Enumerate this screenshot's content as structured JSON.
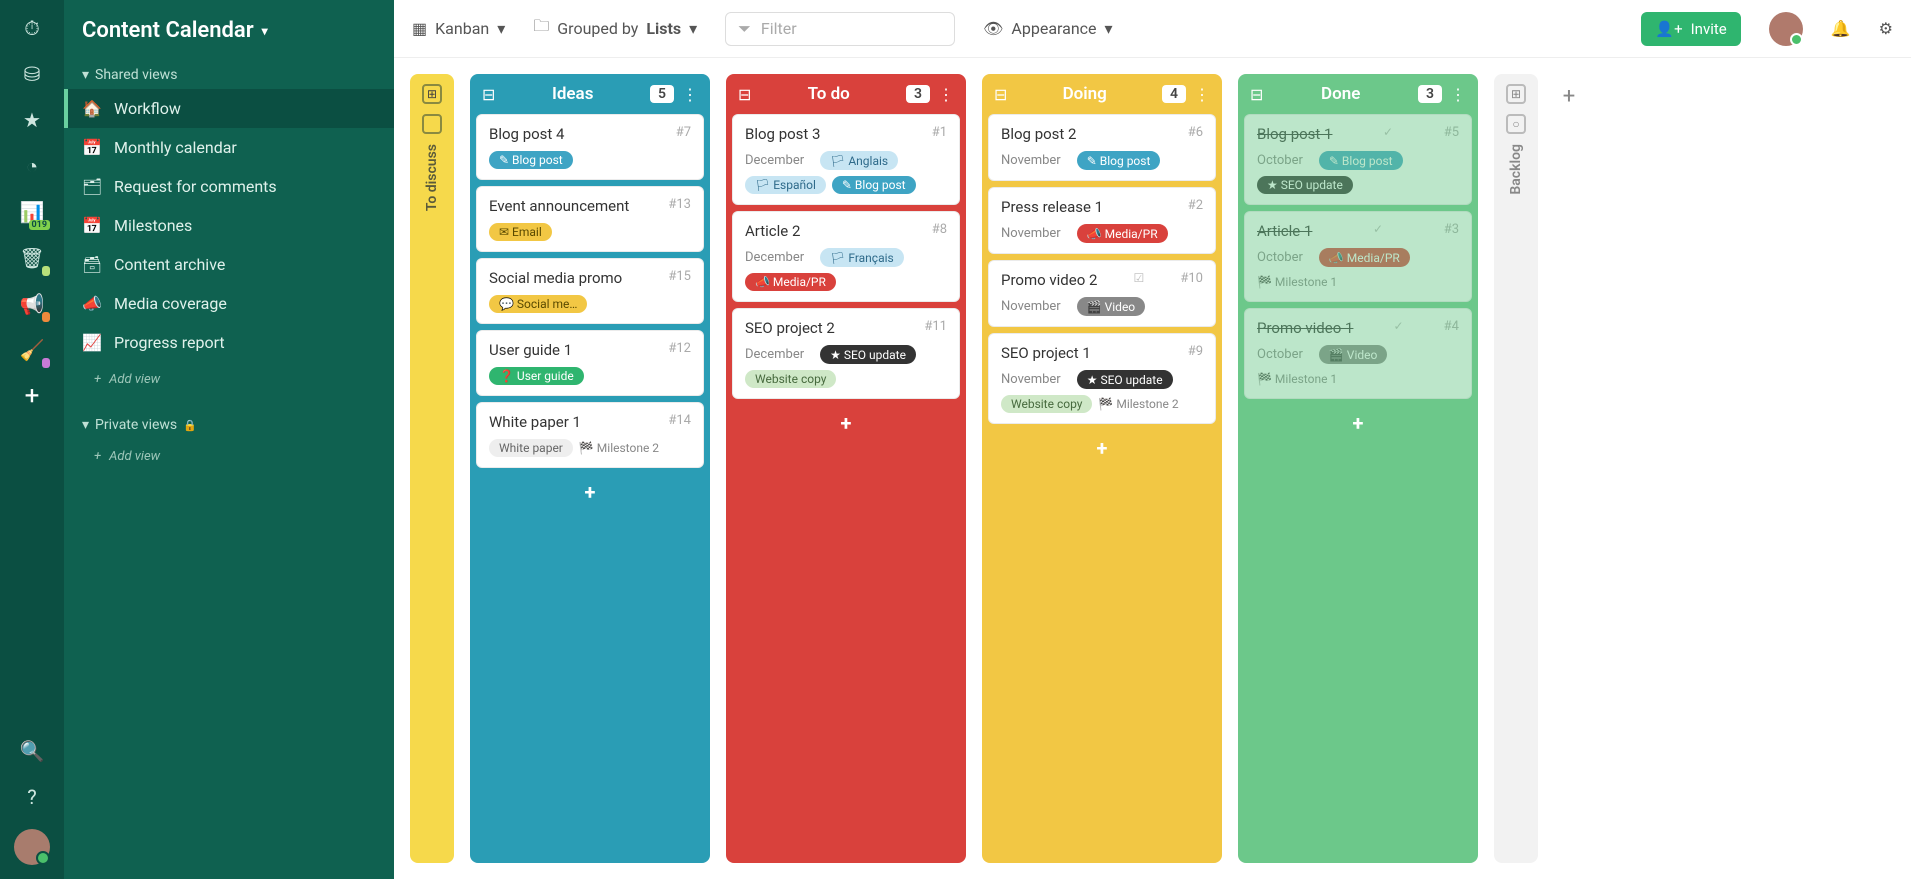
{
  "app": {
    "title": "Content Calendar"
  },
  "sidebar": {
    "shared_label": "Shared views",
    "private_label": "Private views",
    "add_view": "Add view",
    "items": [
      {
        "icon": "🏠",
        "label": "Workflow",
        "active": true
      },
      {
        "icon": "📅",
        "label": "Monthly calendar"
      },
      {
        "icon": "🗂",
        "label": "Request for comments"
      },
      {
        "icon": "📅",
        "label": "Milestones"
      },
      {
        "icon": "🗃",
        "label": "Content archive"
      },
      {
        "icon": "📣",
        "label": "Media coverage"
      },
      {
        "icon": "📈",
        "label": "Progress report"
      }
    ]
  },
  "topbar": {
    "view": "Kanban",
    "group_prefix": "Grouped by",
    "group_value": "Lists",
    "filter_placeholder": "Filter",
    "appearance": "Appearance",
    "invite": "Invite"
  },
  "collapsed_left": {
    "title": "To discuss"
  },
  "collapsed_right": {
    "title": "Backlog"
  },
  "columns": [
    {
      "title": "Ideas",
      "count": "5",
      "style": "col-ideas",
      "cards": [
        {
          "title": "Blog post 4",
          "id": "#7",
          "tags": [
            {
              "cls": "tag-blog",
              "icon": "✎",
              "label": "Blog post"
            }
          ]
        },
        {
          "title": "Event announcement",
          "id": "#13",
          "tags": [
            {
              "cls": "tag-email",
              "icon": "✉",
              "label": "Email"
            }
          ]
        },
        {
          "title": "Social media promo",
          "id": "#15",
          "tags": [
            {
              "cls": "tag-social",
              "icon": "💬",
              "label": "Social me…"
            }
          ]
        },
        {
          "title": "User guide 1",
          "id": "#12",
          "tags": [
            {
              "cls": "tag-userguide",
              "icon": "❓",
              "label": "User guide"
            }
          ]
        },
        {
          "title": "White paper 1",
          "id": "#14",
          "tags": [
            {
              "cls": "tag-white",
              "label": "White paper"
            },
            {
              "cls": "tag-mile",
              "icon": "🏁",
              "label": "Milestone 2"
            }
          ]
        }
      ]
    },
    {
      "title": "To do",
      "count": "3",
      "style": "col-todo",
      "cards": [
        {
          "title": "Blog post 3",
          "id": "#1",
          "tags": [
            {
              "cls": "tag-date",
              "label": "December"
            },
            {
              "cls": "tag-flag",
              "icon": "🏳",
              "label": "Anglais"
            },
            {
              "cls": "tag-flag",
              "icon": "🏳",
              "label": "Español"
            },
            {
              "cls": "tag-blog",
              "icon": "✎",
              "label": "Blog post"
            }
          ]
        },
        {
          "title": "Article 2",
          "id": "#8",
          "tags": [
            {
              "cls": "tag-date",
              "label": "December"
            },
            {
              "cls": "tag-flag",
              "icon": "🏳",
              "label": "Français"
            },
            {
              "cls": "tag-media",
              "icon": "📣",
              "label": "Media/PR"
            }
          ]
        },
        {
          "title": "SEO project 2",
          "id": "#11",
          "tags": [
            {
              "cls": "tag-date",
              "label": "December"
            },
            {
              "cls": "tag-seo",
              "icon": "★",
              "label": "SEO update"
            },
            {
              "cls": "tag-webcopy",
              "label": "Website copy"
            }
          ]
        }
      ]
    },
    {
      "title": "Doing",
      "count": "4",
      "style": "col-doing",
      "cards": [
        {
          "title": "Blog post 2",
          "id": "#6",
          "tags": [
            {
              "cls": "tag-date",
              "label": "November"
            },
            {
              "cls": "tag-blog",
              "icon": "✎",
              "label": "Blog post"
            }
          ]
        },
        {
          "title": "Press release 1",
          "id": "#2",
          "tags": [
            {
              "cls": "tag-date",
              "label": "November"
            },
            {
              "cls": "tag-media",
              "icon": "📣",
              "label": "Media/PR"
            }
          ]
        },
        {
          "title": "Promo video 2",
          "id": "#10",
          "strike_icon": true,
          "tags": [
            {
              "cls": "tag-date",
              "label": "November"
            },
            {
              "cls": "tag-video",
              "icon": "🎬",
              "label": "Video"
            }
          ]
        },
        {
          "title": "SEO project 1",
          "id": "#9",
          "tags": [
            {
              "cls": "tag-date",
              "label": "November"
            },
            {
              "cls": "tag-seo",
              "icon": "★",
              "label": "SEO update"
            },
            {
              "cls": "tag-webcopy",
              "label": "Website copy"
            },
            {
              "cls": "tag-mile",
              "icon": "🏁",
              "label": "Milestone 2"
            }
          ]
        }
      ]
    },
    {
      "title": "Done",
      "count": "3",
      "style": "col-done",
      "cards": [
        {
          "title": "Blog post 1",
          "id": "#5",
          "done": true,
          "tags": [
            {
              "cls": "tag-date",
              "label": "October"
            },
            {
              "cls": "tag-blog",
              "icon": "✎",
              "label": "Blog post"
            },
            {
              "cls": "tag-seo",
              "icon": "★",
              "label": "SEO update"
            }
          ]
        },
        {
          "title": "Article 1",
          "id": "#3",
          "done": true,
          "tags": [
            {
              "cls": "tag-date",
              "label": "October"
            },
            {
              "cls": "tag-media",
              "icon": "📣",
              "label": "Media/PR"
            },
            {
              "cls": "tag-mile",
              "icon": "🏁",
              "label": "Milestone 1"
            }
          ]
        },
        {
          "title": "Promo video 1",
          "id": "#4",
          "done": true,
          "tags": [
            {
              "cls": "tag-date",
              "label": "October"
            },
            {
              "cls": "tag-video",
              "icon": "🎬",
              "label": "Video"
            },
            {
              "cls": "tag-mile",
              "icon": "🏁",
              "label": "Milestone 1"
            }
          ]
        }
      ]
    }
  ]
}
